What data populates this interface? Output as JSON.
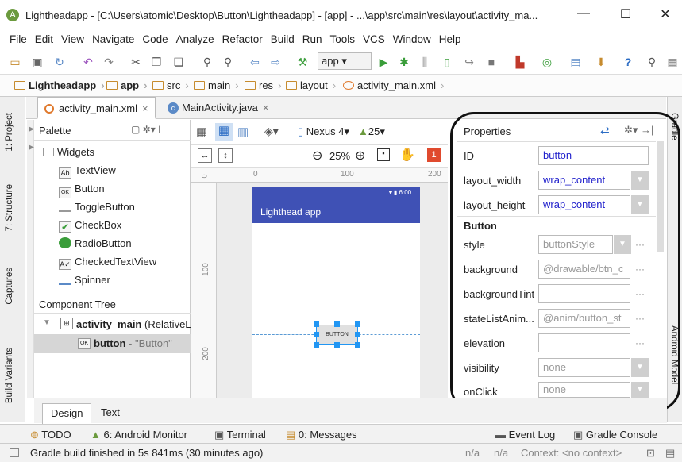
{
  "window": {
    "title": "Lightheadapp - [C:\\Users\\atomic\\Desktop\\Button\\Lightheadapp] - [app] - ...\\app\\src\\main\\res\\layout\\activity_ma...",
    "minimize": "—",
    "maximize": "☐",
    "close": "✕"
  },
  "menu": [
    "File",
    "Edit",
    "View",
    "Navigate",
    "Code",
    "Analyze",
    "Refactor",
    "Build",
    "Run",
    "Tools",
    "VCS",
    "Window",
    "Help"
  ],
  "toolbar": {
    "app_selector": "app"
  },
  "breadcrumb": [
    "Lightheadapp",
    "app",
    "src",
    "main",
    "res",
    "layout",
    "activity_main.xml"
  ],
  "left_strip": [
    "1: Project",
    "7: Structure",
    "Captures",
    "Build Variants"
  ],
  "right_strip": [
    "Gradle",
    "Android Model"
  ],
  "file_tabs": [
    {
      "label": "activity_main.xml",
      "close": "×",
      "active": true
    },
    {
      "label": "MainActivity.java",
      "close": "×",
      "active": false
    }
  ],
  "palette": {
    "title": "Palette",
    "group": "Widgets",
    "items": [
      "TextView",
      "Button",
      "ToggleButton",
      "CheckBox",
      "RadioButton",
      "CheckedTextView",
      "Spinner"
    ],
    "icon_text": {
      "textview": "Ab",
      "button": "OK",
      "checked": "A✓"
    }
  },
  "component_tree": {
    "title": "Component Tree",
    "root_name": "activity_main",
    "root_type": "(RelativeLa",
    "child_name": "button",
    "child_text": "- \"Button\""
  },
  "canvas": {
    "device": "Nexus 4",
    "api": "25",
    "zoom": "25%",
    "error_count": "1",
    "ruler_h": [
      "0",
      "100",
      "200"
    ],
    "ruler_v": [
      "100",
      "200"
    ],
    "zero_v": "0",
    "status_time": "6:00",
    "app_title": "Lighthead app",
    "button_text": "BUTTON"
  },
  "properties": {
    "title": "Properties",
    "section": "Button",
    "rows": [
      {
        "label": "ID",
        "value": "button"
      },
      {
        "label": "layout_width",
        "value": "wrap_content"
      },
      {
        "label": "layout_height",
        "value": "wrap_content"
      },
      {
        "label": "style",
        "value": "buttonStyle"
      },
      {
        "label": "background",
        "value": "@drawable/btn_c"
      },
      {
        "label": "backgroundTint",
        "value": ""
      },
      {
        "label": "stateListAnim...",
        "value": "@anim/button_st"
      },
      {
        "label": "elevation",
        "value": ""
      },
      {
        "label": "visibility",
        "value": "none"
      },
      {
        "label": "onClick",
        "value": "none"
      }
    ],
    "more": "···"
  },
  "bottom_tabs": [
    "Design",
    "Text"
  ],
  "tool_windows": {
    "left": [
      "TODO",
      "6: Android Monitor",
      "Terminal",
      "0: Messages"
    ],
    "right": [
      "Event Log",
      "Gradle Console"
    ]
  },
  "status": {
    "message": "Gradle build finished in 5s 841ms (30 minutes ago)",
    "na1": "n/a",
    "na2": "n/a",
    "context": "Context: <no context>"
  },
  "colors": {
    "accent": "#3f51b5",
    "selection": "#2196f3",
    "run_green": "#3a9d3a",
    "link_blue": "#2222cc"
  }
}
